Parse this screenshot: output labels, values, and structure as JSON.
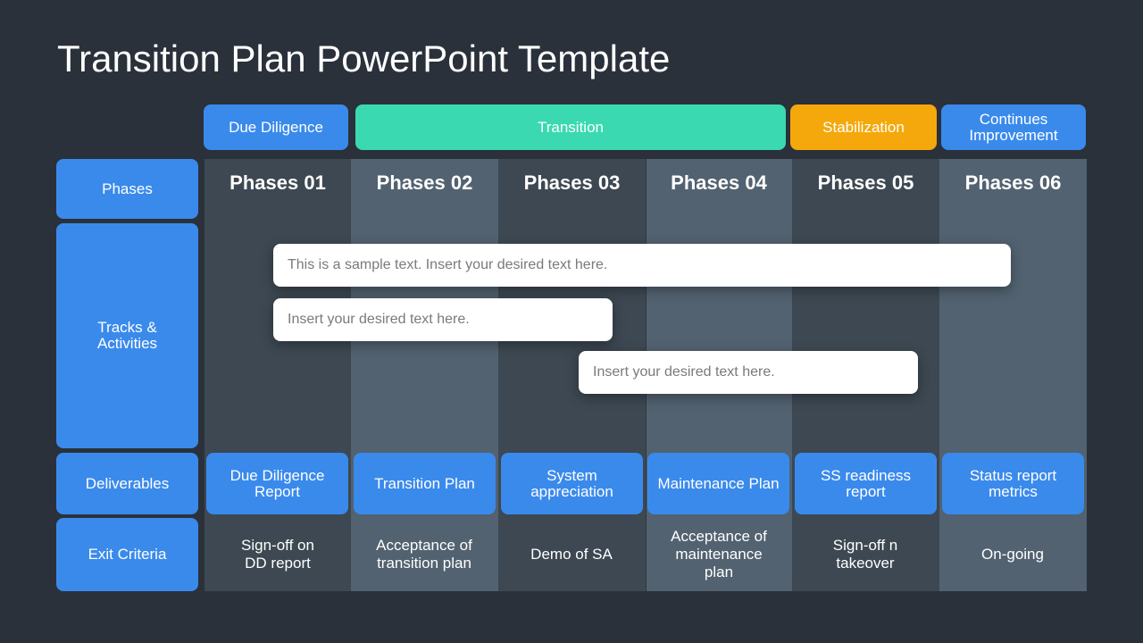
{
  "title": "Transition Plan PowerPoint Template",
  "colors": {
    "background": "#2a313a",
    "blue": "#3a8aec",
    "green": "#3ad9b1",
    "orange": "#f5a80b",
    "column_dark": "#3d4852",
    "column_light": "#526270"
  },
  "stages": [
    {
      "label": "Due Diligence"
    },
    {
      "label": "Transition"
    },
    {
      "label": "Stabilization"
    },
    {
      "label": "Continues Improvement"
    }
  ],
  "row_labels": {
    "phases": "Phases",
    "tracks": "Tracks & Activities",
    "deliverables": "Deliverables",
    "exit_criteria": "Exit Criteria"
  },
  "phases": [
    {
      "title": "Phases 01",
      "deliverable": "Due Diligence Report",
      "exit": "Sign-off on DD report"
    },
    {
      "title": "Phases 02",
      "deliverable": "Transition Plan",
      "exit": "Acceptance of transition plan"
    },
    {
      "title": "Phases 03",
      "deliverable": "System appreciation",
      "exit": "Demo of SA"
    },
    {
      "title": "Phases 04",
      "deliverable": "Maintenance Plan",
      "exit": "Acceptance of maintenance plan"
    },
    {
      "title": "Phases 05",
      "deliverable": "SS readiness report",
      "exit": "Sign-off n takeover"
    },
    {
      "title": "Phases 06",
      "deliverable": "Status report metrics",
      "exit": "On-going"
    }
  ],
  "tracks": [
    {
      "text": "This is a sample text. Insert your desired text here."
    },
    {
      "text": "Insert your desired text here."
    },
    {
      "text": "Insert your desired text here."
    }
  ]
}
